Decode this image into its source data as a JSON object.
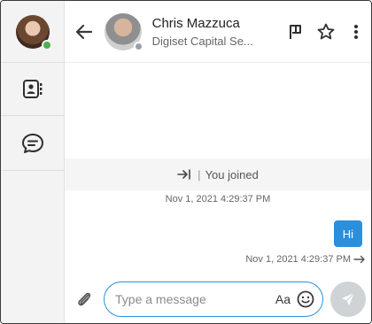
{
  "user": {
    "status": "online"
  },
  "rail": {
    "items": [
      {
        "icon": "contacts-icon"
      },
      {
        "icon": "chats-icon"
      }
    ]
  },
  "header": {
    "back_icon": "arrow-left-icon",
    "contact_name": "Chris Mazzuca",
    "contact_subtitle": "Digiset Capital Se...",
    "contact_status": "away",
    "actions": [
      {
        "icon": "flag-icon"
      },
      {
        "icon": "star-icon"
      },
      {
        "icon": "more-vertical-icon"
      }
    ]
  },
  "conversation": {
    "system_event": {
      "icon": "joined-arrow-icon",
      "text": "You joined"
    },
    "system_timestamp": "Nov 1, 2021 4:29:37 PM",
    "messages": [
      {
        "text": "Hi",
        "timestamp": "Nov 1, 2021 4:29:37 PM",
        "direction": "outgoing"
      }
    ]
  },
  "composer": {
    "placeholder": "Type a message",
    "value": "",
    "format_label": "Aa"
  },
  "colors": {
    "accent": "#2a8fdc",
    "online": "#4caf50",
    "away": "#9aa0a6"
  }
}
